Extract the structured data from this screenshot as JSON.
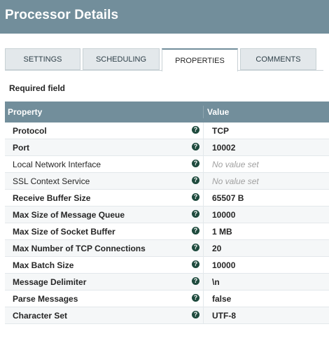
{
  "header": {
    "title": "Processor Details"
  },
  "tabs": [
    {
      "label": "SETTINGS"
    },
    {
      "label": "SCHEDULING"
    },
    {
      "label": "PROPERTIES"
    },
    {
      "label": "COMMENTS"
    }
  ],
  "required_label": "Required field",
  "table": {
    "headers": {
      "property": "Property",
      "value": "Value"
    },
    "help_glyph": "?",
    "rows": [
      {
        "name": "Protocol",
        "value": "TCP"
      },
      {
        "name": "Port",
        "value": "10002"
      },
      {
        "name": "Local Network Interface",
        "value": "No value set"
      },
      {
        "name": "SSL Context Service",
        "value": "No value set"
      },
      {
        "name": "Receive Buffer Size",
        "value": "65507 B"
      },
      {
        "name": "Max Size of Message Queue",
        "value": "10000"
      },
      {
        "name": "Max Size of Socket Buffer",
        "value": "1 MB"
      },
      {
        "name": "Max Number of TCP Connections",
        "value": "20"
      },
      {
        "name": "Max Batch Size",
        "value": "10000"
      },
      {
        "name": "Message Delimiter",
        "value": "\\n"
      },
      {
        "name": "Parse Messages",
        "value": "false"
      },
      {
        "name": "Character Set",
        "value": "UTF-8"
      }
    ]
  }
}
